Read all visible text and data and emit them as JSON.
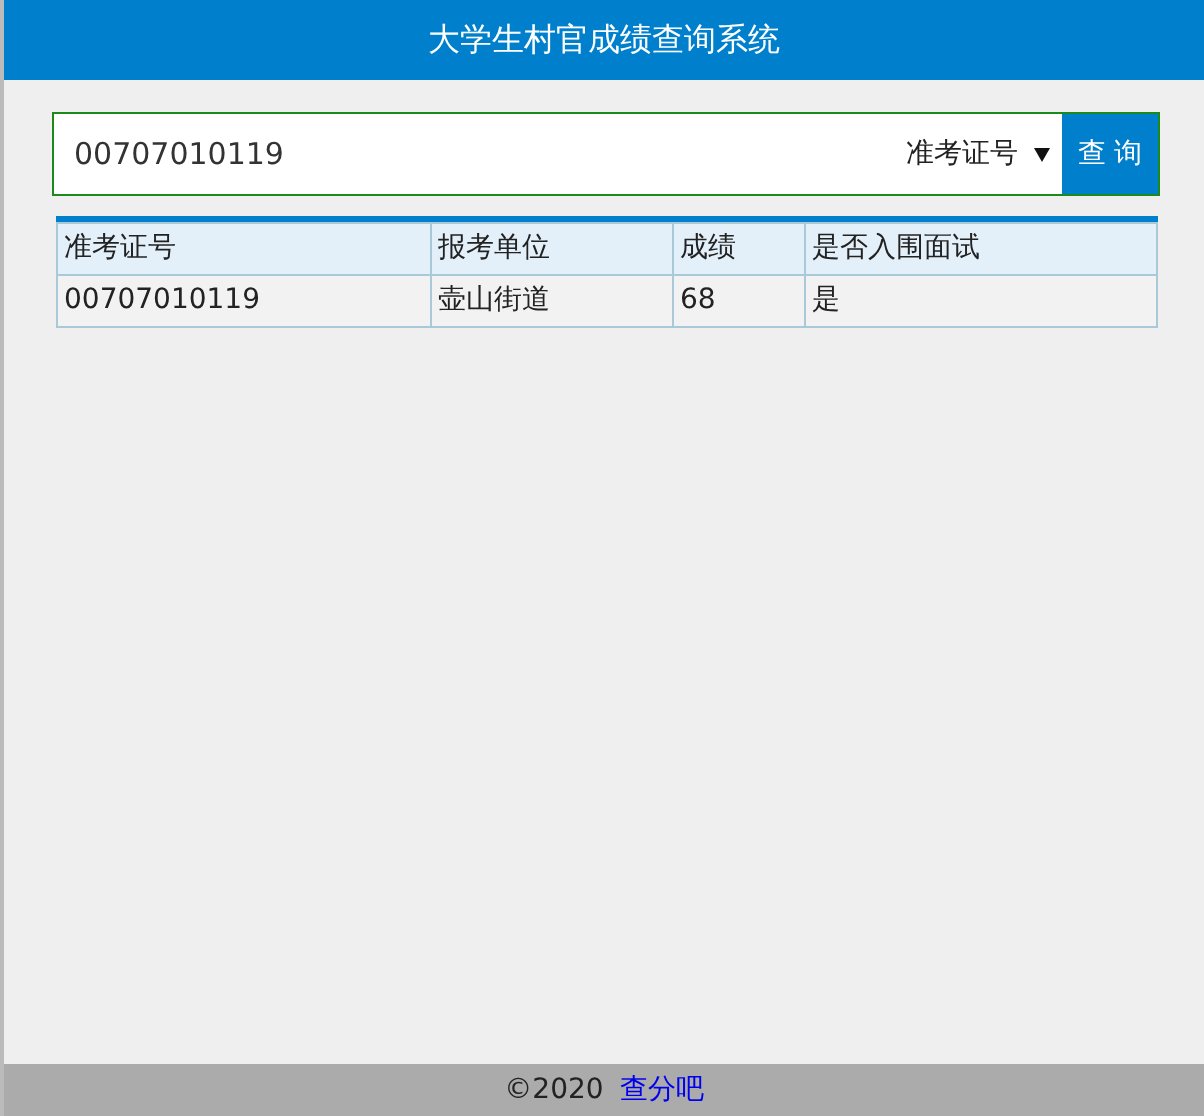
{
  "header": {
    "title": "大学生村官成绩查询系统"
  },
  "search": {
    "value": "00707010119",
    "select_value": "准考证号",
    "button": "查 询"
  },
  "table": {
    "columns": [
      "准考证号",
      "报考单位",
      "成绩",
      "是否入围面试"
    ],
    "rows": [
      [
        "00707010119",
        "壶山街道",
        "68",
        "是"
      ]
    ]
  },
  "footer": {
    "copyright": "©2020",
    "link": "查分吧"
  }
}
